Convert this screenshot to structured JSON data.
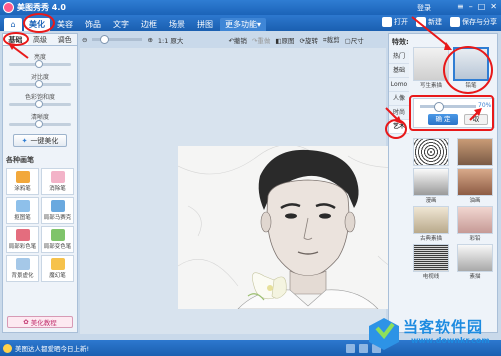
{
  "app": {
    "title": "美图秀秀 4.0",
    "login": "登录"
  },
  "menu": {
    "tabs": [
      "美化",
      "美容",
      "饰品",
      "文字",
      "边框",
      "场景",
      "拼图",
      "更多功能▾"
    ],
    "right": [
      "打开",
      "新建",
      "保存与分享"
    ]
  },
  "left": {
    "tabs": [
      "基础",
      "高级",
      "调色"
    ],
    "sliders": [
      {
        "label": "亮度",
        "value": 0.5
      },
      {
        "label": "对比度",
        "value": 0.5
      },
      {
        "label": "色彩饱和度",
        "value": 0.5
      },
      {
        "label": "清晰度",
        "value": 0.5
      }
    ],
    "auto_button": "一键美化",
    "section": "各种画笔",
    "pens": [
      "涂鸦笔",
      "消除笔",
      "抠图笔",
      "局部马赛克",
      "局部彩色笔",
      "局部变色笔",
      "背景虚化",
      "魔幻笔"
    ],
    "tutorial": "美化教程"
  },
  "canvas_toolbar": {
    "zoom": "1:1 原大",
    "undo": "撤销",
    "redo": "重做",
    "original": "原图",
    "rotate": "旋转",
    "crop": "裁剪",
    "size": "尺寸"
  },
  "right": {
    "title": "特效:",
    "categories": [
      "热门",
      "基础",
      "Lomo",
      "人像",
      "时尚",
      "艺术"
    ],
    "active_category": "艺术",
    "top_thumbs": [
      "写生素描",
      "铅笔"
    ],
    "opacity_value": "70%",
    "ok": "确 定",
    "cancel": "取",
    "effects": [
      "",
      "",
      "漫画",
      "油画",
      "古典素描",
      "彩铅",
      "电视线",
      "素描"
    ]
  },
  "status": {
    "text": "美图达人都爱晒今日上新!"
  },
  "watermark": {
    "name": "当客软件园",
    "url": "www.downkr.com"
  }
}
